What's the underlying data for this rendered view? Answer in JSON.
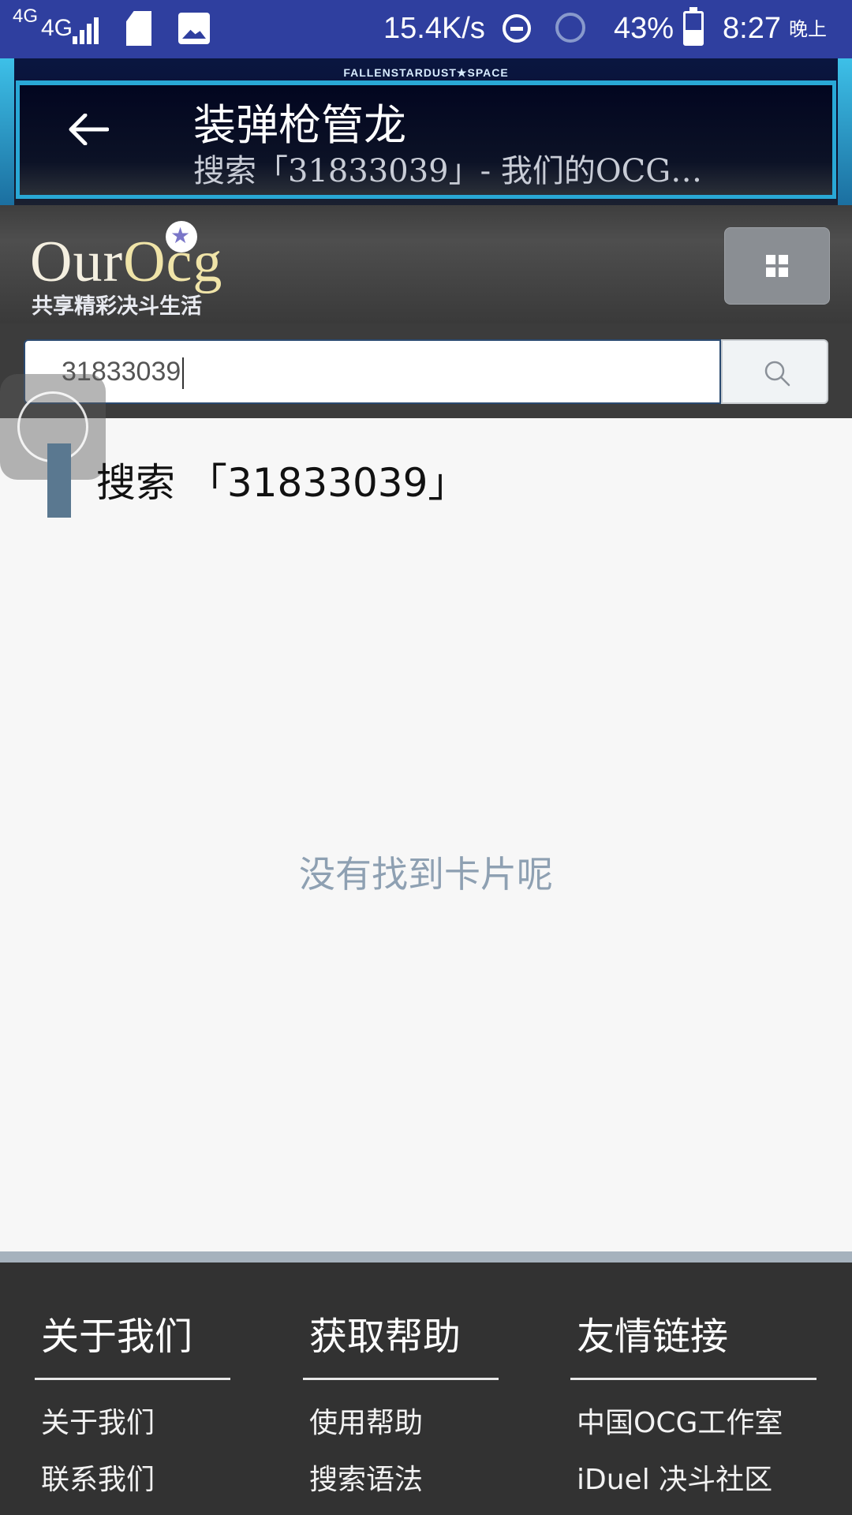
{
  "status_bar": {
    "network_label": "4G",
    "network_label_small": "4G",
    "speed": "15.4K/s",
    "battery": "43%",
    "time": "8:27",
    "time_suffix": "晚上"
  },
  "header": {
    "brand": "FALLENSTARDUST★SPACE",
    "title": "装弹枪管龙",
    "subtitle": "搜索「31833039」- 我们的OCG…",
    "accent_color": "#29a8d6"
  },
  "site": {
    "logo_our": "Our",
    "logo_ocg": "Ocg",
    "slogan": "共享精彩决斗生活"
  },
  "search": {
    "value": "31833039"
  },
  "main": {
    "section_title": "搜索 「31833039」",
    "empty_message": "没有找到卡片呢"
  },
  "footer": {
    "columns": [
      {
        "title": "关于我们",
        "links": [
          "关于我们",
          "联系我们"
        ]
      },
      {
        "title": "获取帮助",
        "links": [
          "使用帮助",
          "搜索语法"
        ]
      },
      {
        "title": "友情链接",
        "links": [
          "中国OCG工作室",
          "iDuel 决斗社区"
        ]
      }
    ]
  }
}
